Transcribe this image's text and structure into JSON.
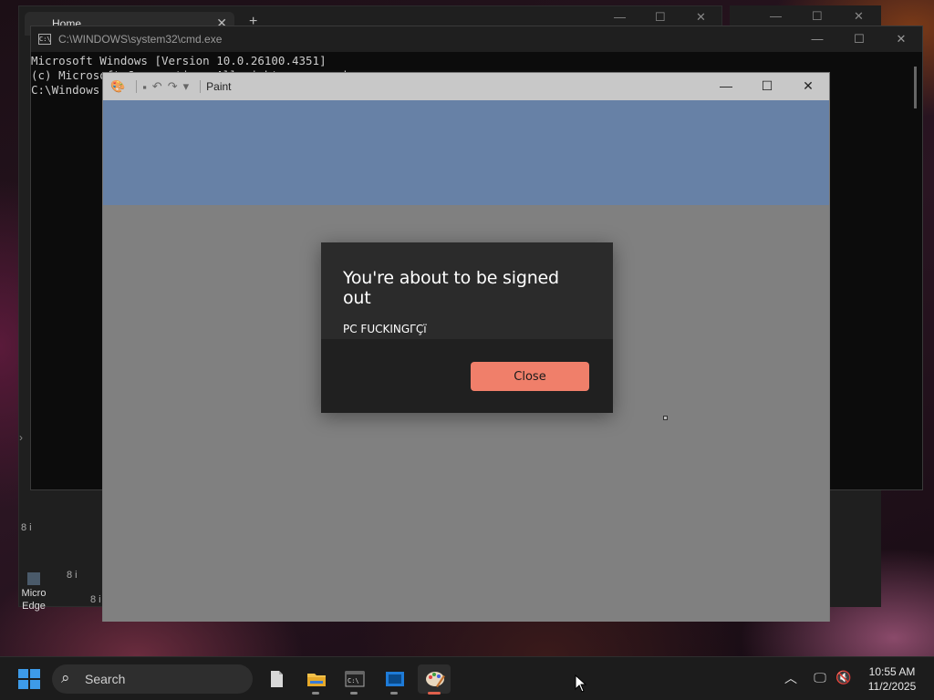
{
  "explorer": {
    "tab_title": "Home",
    "row_labels": [
      "8 i",
      "8 i",
      "8 i"
    ]
  },
  "desktop": {
    "edge_label": "Micro Edge"
  },
  "cmd": {
    "title": "C:\\WINDOWS\\system32\\cmd.exe",
    "lines": [
      "Microsoft Windows [Version 10.0.26100.4351]",
      "(c) Microsoft Corporation. All rights reserved.",
      "",
      "C:\\Windows"
    ]
  },
  "paint": {
    "title": "Paint"
  },
  "dialog": {
    "title": "You're about to be signed out",
    "message": "PC FUCKINGΓÇï",
    "close_label": "Close"
  },
  "taskbar": {
    "search_placeholder": "Search",
    "apps": [
      "file-icon",
      "file-explorer-icon",
      "terminal-icon",
      "app-window-icon",
      "paint-icon"
    ],
    "time": "10:55 AM",
    "date": "11/2/2025"
  },
  "colors": {
    "accent_button": "#f07f6a",
    "paint_ribbon": "#6781a6",
    "start_blue": "#3d9be9"
  }
}
